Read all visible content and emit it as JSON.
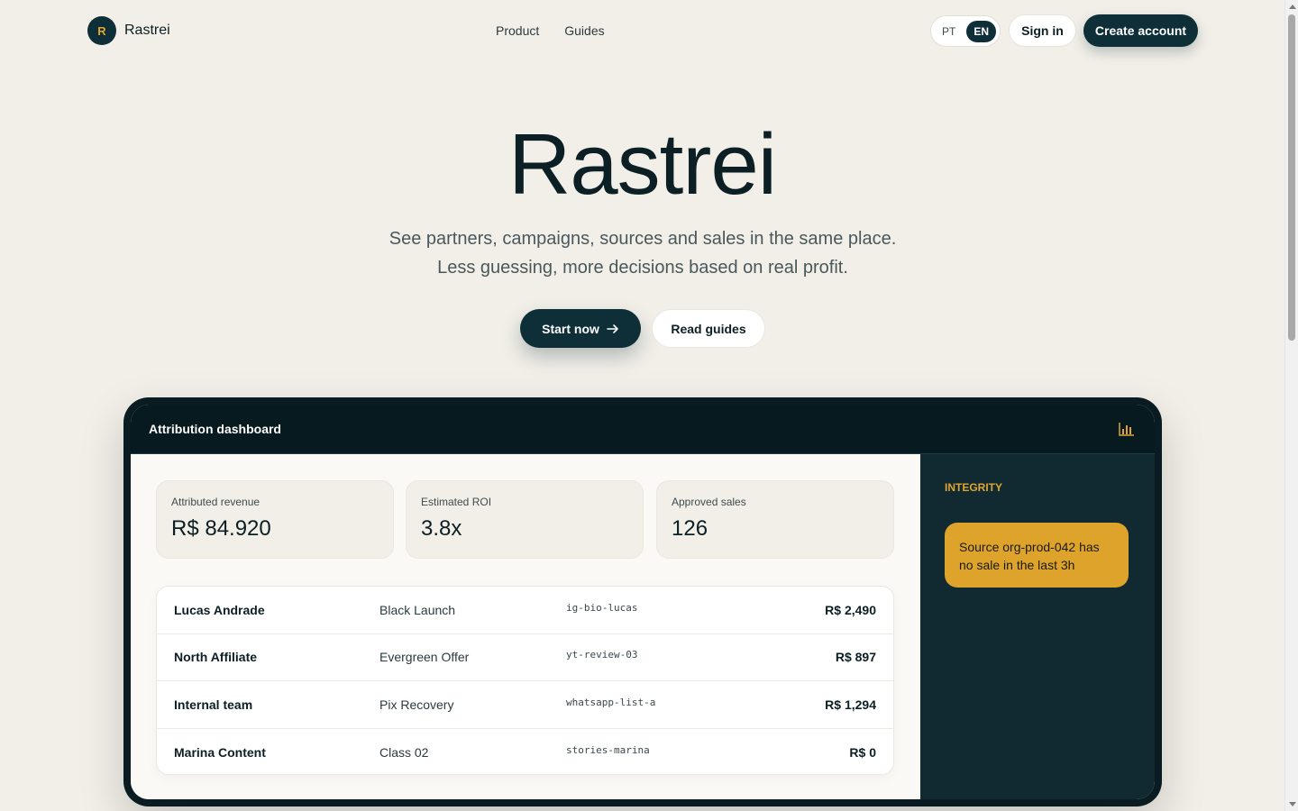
{
  "brand": {
    "mark": "R",
    "name": "Rastrei"
  },
  "nav": {
    "items": [
      "Product",
      "Guides"
    ]
  },
  "language": {
    "options": [
      "PT",
      "EN"
    ],
    "selected": "EN"
  },
  "header": {
    "signin_label": "Sign in",
    "create_label": "Create account"
  },
  "hero": {
    "title": "Rastrei",
    "subtitle": "See partners, campaigns, sources and sales in the same place. Less guessing, more decisions based on real profit.",
    "start_label": "Start now",
    "guides_label": "Read guides"
  },
  "dashboard": {
    "title": "Attribution dashboard",
    "metrics": [
      {
        "label": "Attributed revenue",
        "value": "R$ 84.920"
      },
      {
        "label": "Estimated ROI",
        "value": "3.8x"
      },
      {
        "label": "Approved sales",
        "value": "126"
      }
    ],
    "rows": [
      {
        "partner": "Lucas Andrade",
        "campaign": "Black Launch",
        "source": "ig-bio-lucas",
        "amount": "R$ 2,490"
      },
      {
        "partner": "North Affiliate",
        "campaign": "Evergreen Offer",
        "source": "yt-review-03",
        "amount": "R$ 897"
      },
      {
        "partner": "Internal team",
        "campaign": "Pix Recovery",
        "source": "whatsapp-list-a",
        "amount": "R$ 1,294"
      },
      {
        "partner": "Marina Content",
        "campaign": "Class 02",
        "source": "stories-marina",
        "amount": "R$ 0"
      }
    ],
    "integrity": {
      "label": "INTEGRITY",
      "alert": "Source org-prod-042 has no sale in the last 3h"
    }
  },
  "colors": {
    "primary": "#0e2e38",
    "accent": "#e0a530",
    "background": "#f2efe8",
    "alert": "#dea32b"
  },
  "icons": [
    "arrow-right-icon",
    "bar-chart-icon"
  ]
}
